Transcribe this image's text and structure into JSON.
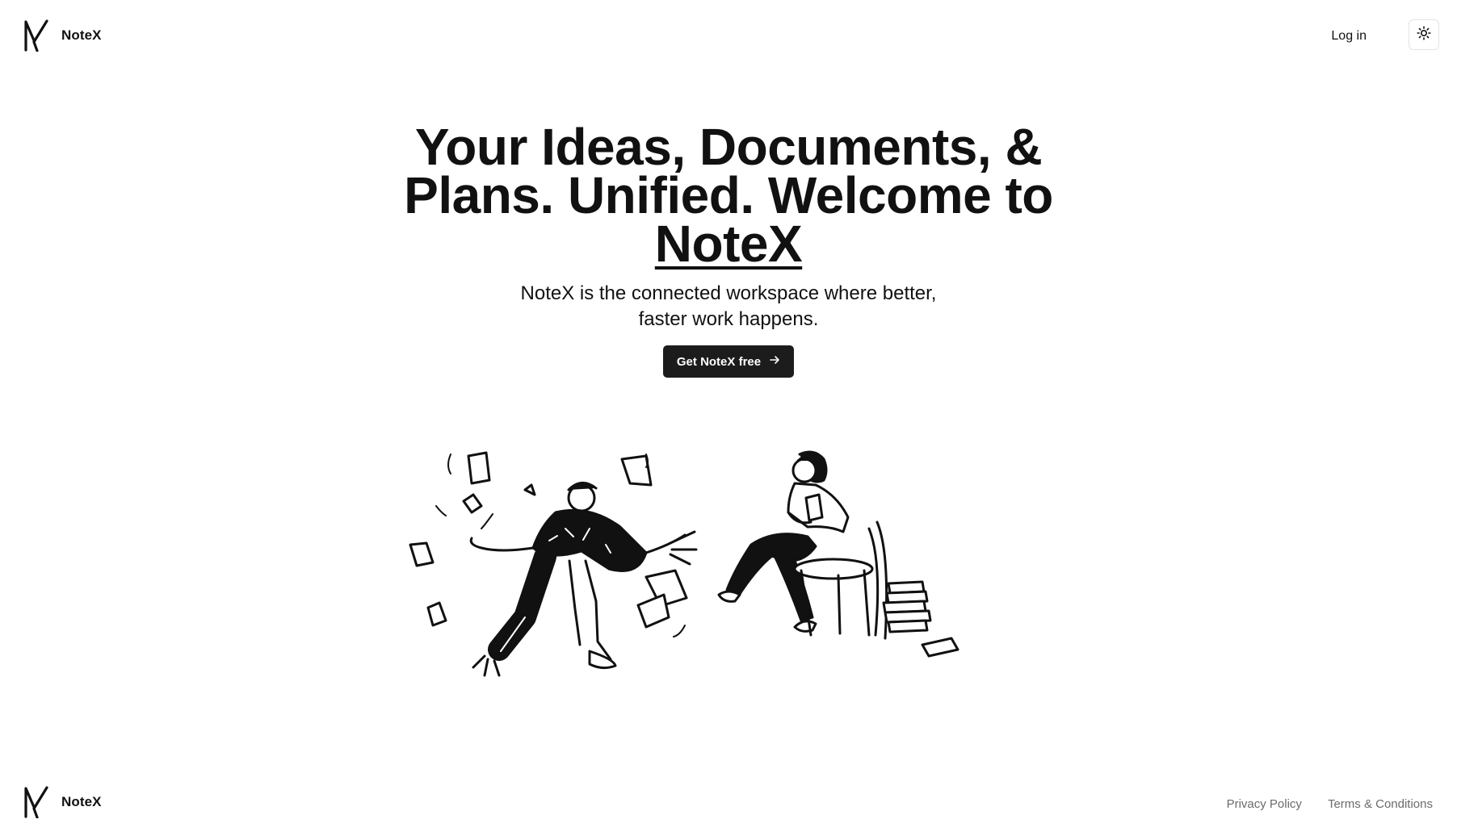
{
  "header": {
    "brand_name": "NoteX",
    "login_label": "Log in",
    "theme_icon": "sun-icon"
  },
  "hero": {
    "headline_part1": "Your Ideas, Documents, & Plans. Unified. Welcome to ",
    "headline_brand": "NoteX",
    "subhead": "NoteX is the connected workspace where better, faster work happens.",
    "cta_label": "Get NoteX free",
    "cta_icon": "arrow-right-icon"
  },
  "illustration": {
    "left_figure": "person-with-flying-papers",
    "right_figure": "person-reading-in-chair"
  },
  "footer": {
    "brand_name": "NoteX",
    "links": [
      "Privacy Policy",
      "Terms & Conditions"
    ]
  },
  "colors": {
    "text": "#111111",
    "button_bg": "#1c1c1c",
    "muted_link": "#6b6b6b",
    "background": "#ffffff"
  }
}
